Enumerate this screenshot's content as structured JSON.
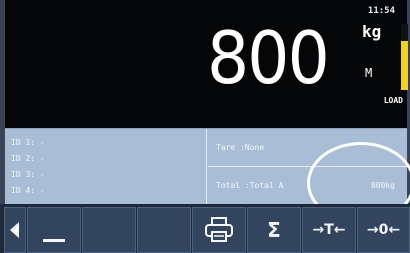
{
  "display": {
    "clock": "11:54",
    "weight": "800",
    "unit": "kg",
    "mode": "M",
    "load_label": "LOAD",
    "load_level": 0.75,
    "load_color": "#f2d21a"
  },
  "ids": [
    {
      "label": "ID 1: -"
    },
    {
      "label": "ID 2: -"
    },
    {
      "label": "ID 3: -"
    },
    {
      "label": "ID 4: -"
    }
  ],
  "tare": {
    "label": "Tare  :None"
  },
  "total": {
    "label": "Total :Total A",
    "value": "800kg"
  },
  "toolbar": {
    "buttons": [
      {
        "name": "back-arrow-icon"
      },
      {
        "name": "underscore-icon"
      },
      {
        "name": "blank-1"
      },
      {
        "name": "blank-2"
      },
      {
        "name": "printer-icon"
      },
      {
        "name": "sigma-icon",
        "text": "Σ"
      },
      {
        "name": "tare-arrow-icon",
        "text": "→T←"
      },
      {
        "name": "zero-arrow-icon",
        "text": "→0←"
      }
    ]
  }
}
